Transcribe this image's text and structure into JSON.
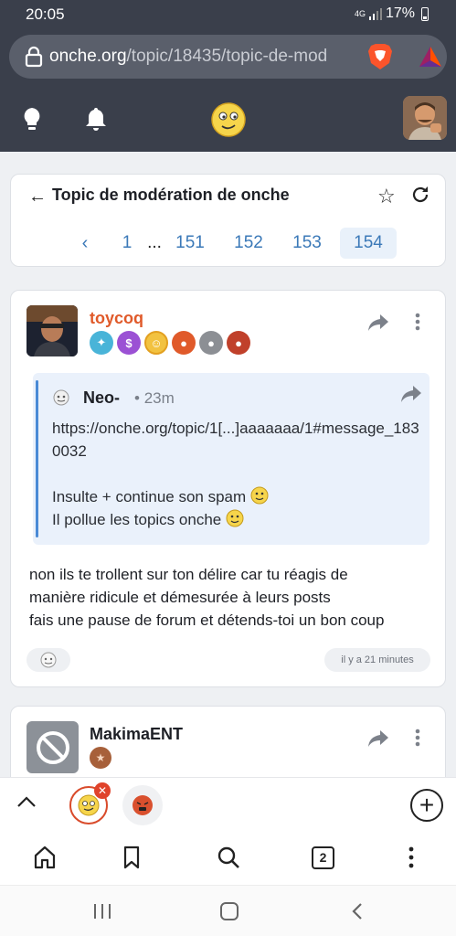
{
  "status_bar": {
    "time": "20:05",
    "signal": "4G",
    "battery": "17%"
  },
  "browser": {
    "url_host": "onche.org",
    "url_path": "/topic/18435/topic-de-mod",
    "tab_count": "2"
  },
  "topic": {
    "title": "Topic de modération de onche",
    "pagination": {
      "prev": "‹",
      "first": "1",
      "ellipsis": "...",
      "pages": [
        "151",
        "152",
        "153",
        "154"
      ],
      "current": "154"
    }
  },
  "post": {
    "author": "toycoq",
    "quote": {
      "author": "Neo-",
      "separator": "•",
      "time": "23m",
      "link": "https://onche.org/topic/1[...]aaaaaaa/1#message_1830032",
      "line1": "Insulte + continue son spam",
      "line2": "Il pollue les topics onche"
    },
    "body_line1": "non ils te trollent sur ton délire car tu réagis de",
    "body_line2": "manière ridicule et démesurée à leurs posts",
    "body_line3": "fais une pause de forum et détends-toi un bon coup",
    "time": "il y a 21 minutes"
  },
  "post2": {
    "author": "MakimaENT"
  },
  "colors": {
    "header_bg": "#3a3f4b",
    "accent": "#e05a2a",
    "link": "#3b79b8",
    "quote_bg": "#eaf1fb"
  },
  "icons": [
    "lock-icon",
    "brave-icon",
    "bat-icon",
    "bulb-icon",
    "bell-icon",
    "onche-logo-icon",
    "share-icon",
    "more-icon",
    "smiley-icon",
    "home-icon",
    "bookmark-icon",
    "search-icon",
    "menu-icon"
  ]
}
